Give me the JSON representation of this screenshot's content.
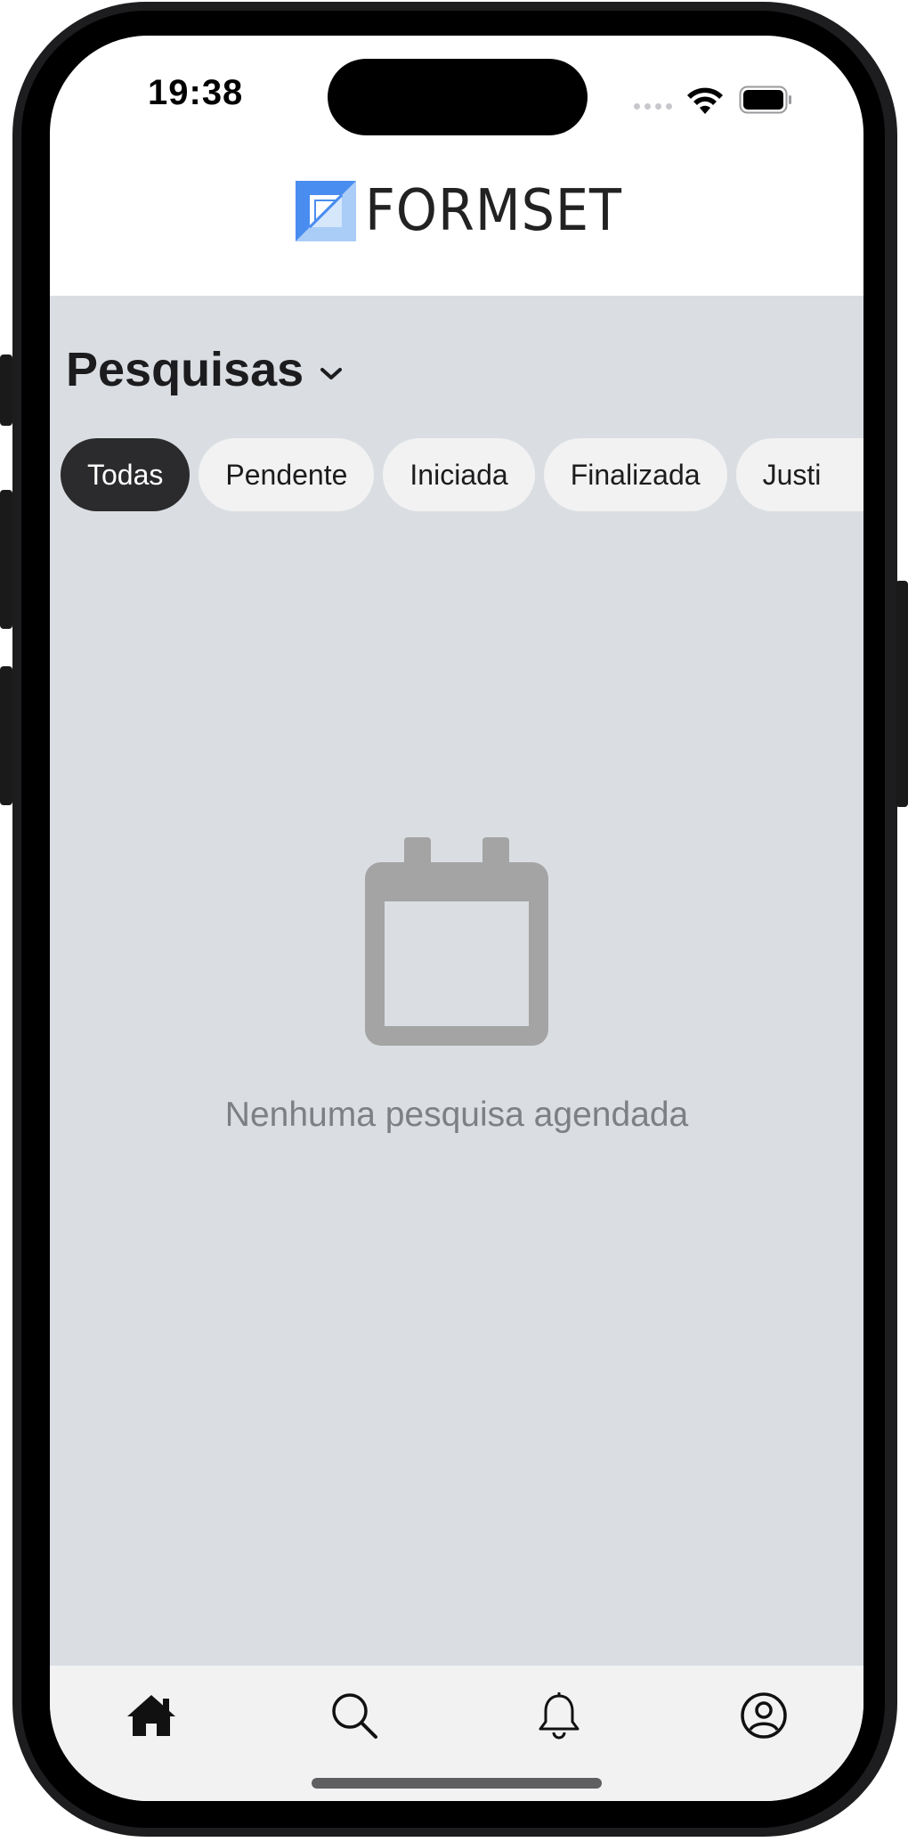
{
  "status_bar": {
    "time": "19:38"
  },
  "header": {
    "logo_text": "FORMSET"
  },
  "page": {
    "title": "Pesquisas"
  },
  "filters": [
    {
      "label": "Todas",
      "active": true
    },
    {
      "label": "Pendente",
      "active": false
    },
    {
      "label": "Iniciada",
      "active": false
    },
    {
      "label": "Finalizada",
      "active": false
    },
    {
      "label": "Justi",
      "active": false
    }
  ],
  "empty_state": {
    "icon": "calendar-icon",
    "message": "Nenhuma pesquisa agendada"
  },
  "tab_bar": [
    {
      "icon": "home-icon",
      "active": true
    },
    {
      "icon": "search-icon",
      "active": false
    },
    {
      "icon": "bell-icon",
      "active": false
    },
    {
      "icon": "profile-icon",
      "active": false
    }
  ],
  "colors": {
    "active_chip": "#2b2b2d",
    "background": "#dadee2",
    "logo_blue": "#4a8df0"
  }
}
